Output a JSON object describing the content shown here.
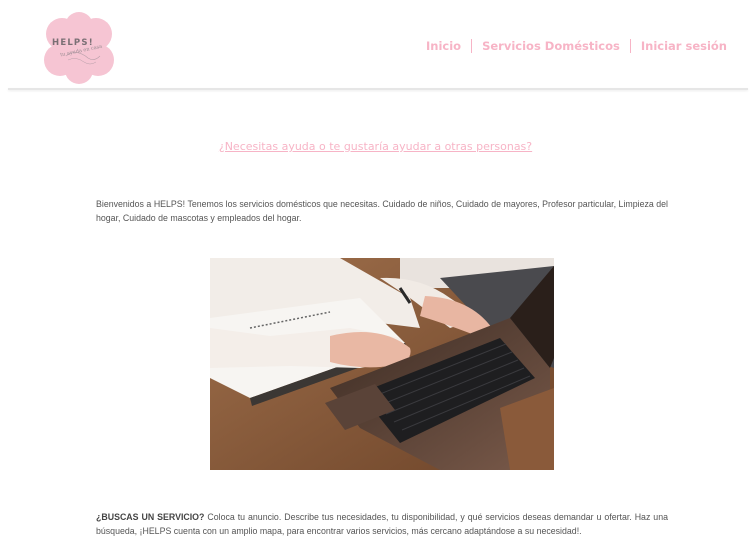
{
  "logo": {
    "brand": "HELPS!",
    "tagline": "tu ayuda en casa"
  },
  "nav": {
    "items": [
      {
        "label": "Inicio"
      },
      {
        "label": "Servicios Domésticos"
      },
      {
        "label": "Iniciar sesión"
      }
    ]
  },
  "main": {
    "headline": "¿Necesitas ayuda o te gustaría ayudar a otras personas?",
    "intro": "Bienvenidos a HELPS! Tenemos los servicios domésticos que necesitas. Cuidado de niños, Cuidado de mayores, Profesor particular, Limpieza del hogar, Cuidado de mascotas y empleados del hogar.",
    "image_subject": "hands-typing-on-laptop",
    "bottom_lead": "¿BUSCAS UN SERVICIO?",
    "bottom_text": " Coloca tu anuncio. Describe tus necesidades, tu disponibilidad, y qué servicios deseas demandar u ofertar. Haz una búsqueda, ¡HELPS cuenta con un amplio mapa, para encontrar varios servicios, más cercano adaptándose a su necesidad!."
  },
  "colors": {
    "accent_pink": "#f7b4c6",
    "logo_pink": "#f6c5d3",
    "body_text": "#555555"
  }
}
